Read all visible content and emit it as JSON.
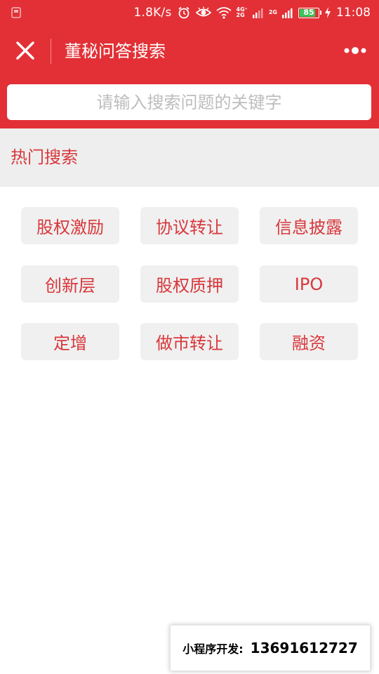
{
  "status_bar": {
    "net_speed": "1.8K/s",
    "net_tag_top": "4G⁺",
    "net_tag_bottom": "2G",
    "net_tag_2": "2G",
    "battery": "85",
    "battery_level": 0.85,
    "time": "11:08"
  },
  "nav": {
    "title": "董秘问答搜索",
    "close_icon": "close-icon",
    "more_icon": "more-dots-icon"
  },
  "search": {
    "placeholder": "请输入搜索问题的关键字",
    "value": ""
  },
  "hot": {
    "title": "热门搜索",
    "tags": [
      "股权激励",
      "协议转让",
      "信息披露",
      "创新层",
      "股权质押",
      "IPO",
      "定增",
      "做市转让",
      "融资"
    ]
  },
  "contact": {
    "label": "小程序开发:",
    "number": "13691612727"
  },
  "colors": {
    "accent": "#e23036",
    "tag_text": "#d8373b",
    "tag_bg": "#f0f0f0",
    "section_bg": "#eeeeee"
  }
}
